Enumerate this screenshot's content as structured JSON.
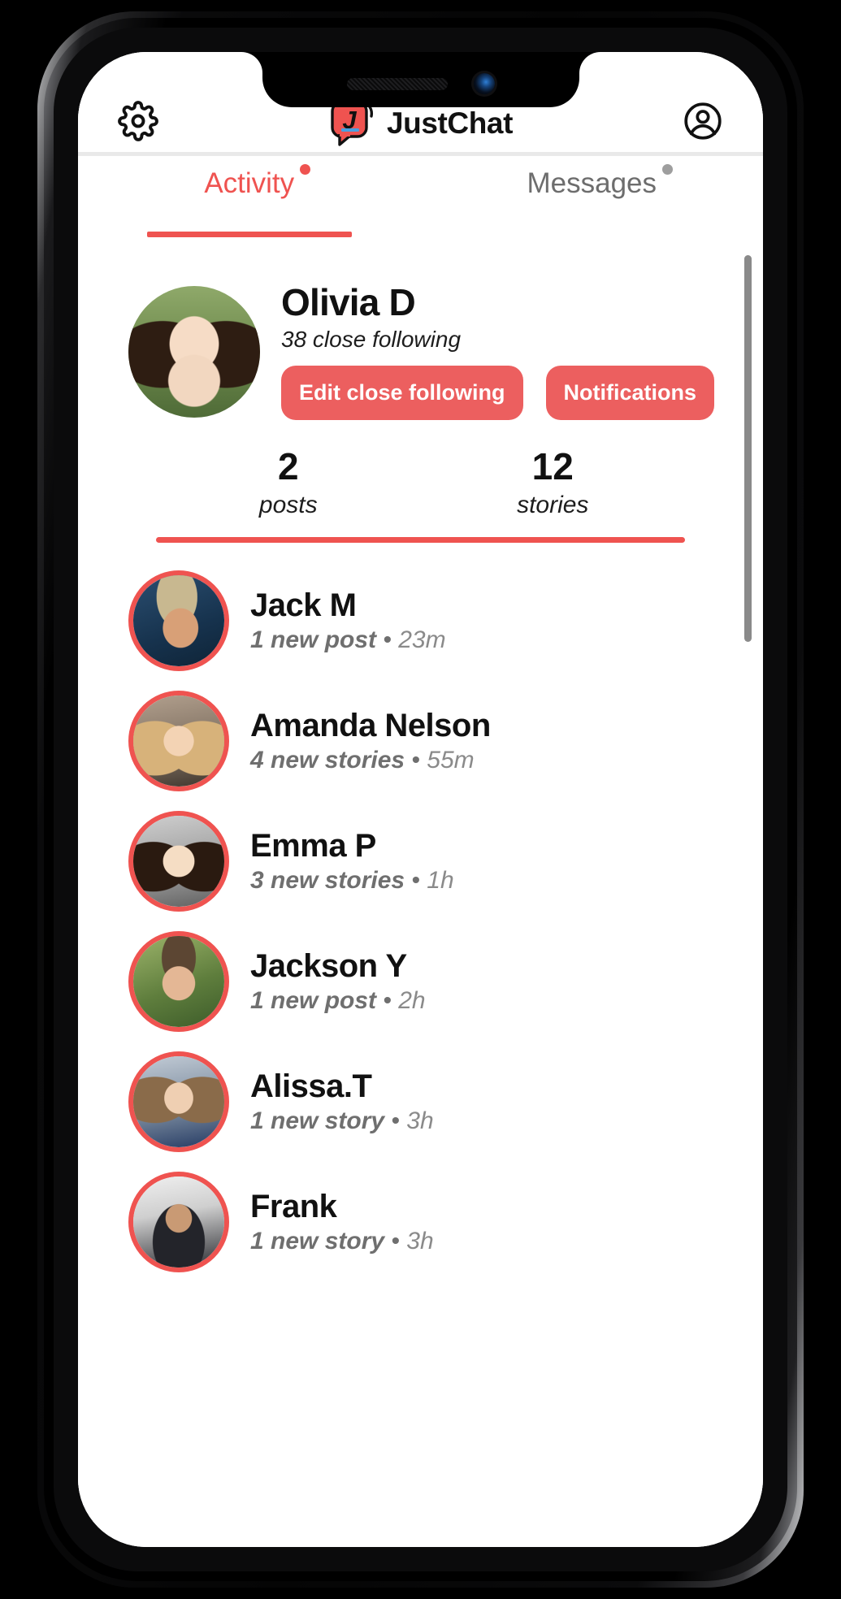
{
  "device": {
    "notch": {
      "speaker_icon": "speaker-grille",
      "camera_icon": "front-camera-lens"
    },
    "buttons": {
      "silent_switch": "silent-switch",
      "volume_up": "volume-up-button",
      "volume_down": "volume-down-button",
      "power": "power-button"
    }
  },
  "colors": {
    "accent": "#ef5350",
    "button": "#ec5f5f",
    "inactive_tab": "#6d6d6d",
    "meta_text": "#6f6f6f",
    "logo_bubble": "#ef5350",
    "logo_underline": "#4a9fe0"
  },
  "header": {
    "settings_icon": "gear-icon",
    "brand_logo_icon": "justchat-logo-icon",
    "brand_logo_letter": "J",
    "title": "JustChat",
    "profile_icon": "account-circle-icon"
  },
  "tabs": [
    {
      "label": "Activity",
      "active": true,
      "badge_dot": true,
      "badge_color": "#ef5350"
    },
    {
      "label": "Messages",
      "active": false,
      "badge_dot": true,
      "badge_color": "#9e9e9e"
    }
  ],
  "profile": {
    "avatar_alt": "olivia-avatar",
    "name": "Olivia D",
    "subtitle": "38 close following",
    "buttons": [
      {
        "label": "Edit close following",
        "name": "edit-close-following-button"
      },
      {
        "label": "Notifications",
        "name": "notifications-button"
      }
    ]
  },
  "stats": [
    {
      "value": "2",
      "label": "posts"
    },
    {
      "value": "12",
      "label": "stories"
    }
  ],
  "activity": [
    {
      "name": "Jack M",
      "event": "1 new post",
      "separator": "•",
      "time": "23m",
      "avatar": "ph-jack"
    },
    {
      "name": "Amanda Nelson",
      "event": "4 new stories",
      "separator": "•",
      "time": "55m",
      "avatar": "ph-amanda"
    },
    {
      "name": "Emma P",
      "event": "3 new stories",
      "separator": "•",
      "time": "1h",
      "avatar": "ph-emma"
    },
    {
      "name": "Jackson Y",
      "event": "1 new post",
      "separator": "•",
      "time": "2h",
      "avatar": "ph-jackson"
    },
    {
      "name": "Alissa.T",
      "event": "1 new story",
      "separator": "•",
      "time": "3h",
      "avatar": "ph-alissa"
    },
    {
      "name": "Frank",
      "event": "1 new story",
      "separator": "•",
      "time": "3h",
      "avatar": "ph-frank"
    }
  ],
  "scrollbar": {
    "name": "vertical-scrollbar"
  }
}
